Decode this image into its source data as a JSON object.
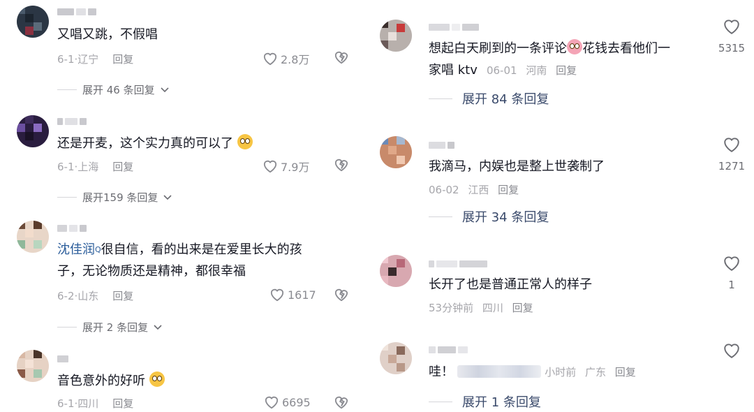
{
  "colors": {
    "text": "#161823",
    "muted": "#a6a6ab",
    "link": "#2a5c9a",
    "expand_right": "#3a4a6b",
    "heart": "#8a8b91"
  },
  "left": [
    {
      "text": "又唱又跳，不假唱",
      "meta": {
        "date": "6-1",
        "location": "辽宁",
        "reply": "回复"
      },
      "likes": "2.8万",
      "expand": "展开 46 条回复"
    },
    {
      "text": "还是开麦，这个实力真的可以了",
      "emoji": "astonished-emoji",
      "meta": {
        "date": "6-1",
        "location": "上海",
        "reply": "回复"
      },
      "likes": "7.9万",
      "expand": "展开159 条回复"
    },
    {
      "mention": "沈佳润",
      "mention_sup": "Q",
      "text_line1": "很自信，看的出来是在爱里长大的孩",
      "text_line2": "子，无论物质还是精神，都很幸福",
      "meta": {
        "date": "6-2",
        "location": "山东",
        "reply": "回复"
      },
      "likes": "1617",
      "expand": "展开 2 条回复"
    },
    {
      "text": "音色意外的好听",
      "emoji": "astonished-emoji",
      "meta": {
        "date": "6-1",
        "location": "四川",
        "reply": "回复"
      },
      "likes": "6695"
    }
  ],
  "right": [
    {
      "text_line1": "想起白天刷到的一条评论",
      "text_after_emoji": "花钱去看他们一",
      "text_line2": "家唱 ktv",
      "meta": {
        "date": "06-01",
        "location": "河南",
        "reply": "回复"
      },
      "likes": "5315",
      "expand": "展开 84 条回复"
    },
    {
      "text": "我滴马，内娱也是整上世袭制了",
      "meta": {
        "date": "06-02",
        "location": "江西",
        "reply": "回复"
      },
      "likes": "1271",
      "expand": "展开 34 条回复"
    },
    {
      "text": "长开了也是普通正常人的样子",
      "meta": {
        "date": "53分钟前",
        "location": "四川",
        "reply": "回复"
      },
      "likes": "1"
    },
    {
      "text": "哇！",
      "meta": {
        "date": "小时前",
        "location": "广东",
        "reply": "回复"
      },
      "expand": "展开 1 条回复"
    }
  ]
}
